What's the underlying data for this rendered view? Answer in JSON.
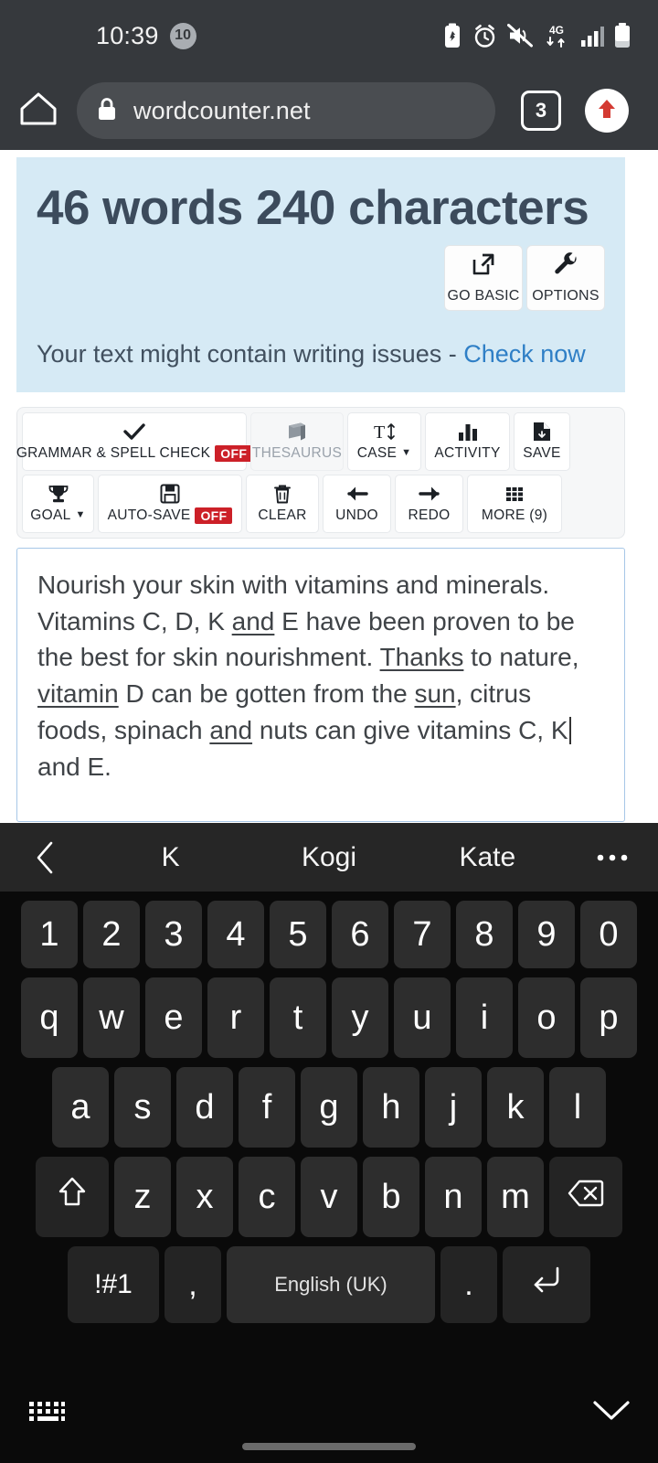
{
  "status_bar": {
    "time": "10:39",
    "notification_count": "10",
    "icons": [
      "battery-saver-icon",
      "alarm-icon",
      "mute-icon",
      "network-4g-icon",
      "signal-bars-icon",
      "battery-icon"
    ]
  },
  "browser": {
    "home_icon": "home-icon",
    "lock_icon": "lock-icon",
    "url": "wordcounter.net",
    "tab_count": "3",
    "upload_icon": "upload-arrow-icon"
  },
  "hero": {
    "headline": "46 words 240 characters",
    "word_count": "46",
    "character_count": "240",
    "buttons": [
      {
        "label": "GO BASIC",
        "icon": "external-link-icon"
      },
      {
        "label": "OPTIONS",
        "icon": "wrench-icon"
      }
    ],
    "notice_text": "Your text might contain writing issues - ",
    "notice_link": "Check now",
    "bg_color": "#d6eaf5",
    "link_color": "#2f7fc6"
  },
  "toolbar": {
    "row1": [
      {
        "label": "GRAMMAR & SPELL CHECK",
        "icon": "check-icon",
        "badge": "OFF",
        "disabled": false,
        "caret": false
      },
      {
        "label": "THESAURUS",
        "icon": "book-icon",
        "badge": "",
        "disabled": true,
        "caret": false
      },
      {
        "label": "CASE",
        "icon": "text-height-icon",
        "badge": "",
        "disabled": false,
        "caret": true
      },
      {
        "label": "ACTIVITY",
        "icon": "bar-chart-icon",
        "badge": "",
        "disabled": false,
        "caret": false
      },
      {
        "label": "SAVE",
        "icon": "save-file-icon",
        "badge": "",
        "disabled": false,
        "caret": false
      },
      {
        "label": "GOAL",
        "icon": "trophy-icon",
        "badge": "",
        "disabled": false,
        "caret": true
      }
    ],
    "row2": [
      {
        "label": "AUTO-SAVE",
        "icon": "floppy-disk-icon",
        "badge": "OFF",
        "disabled": false,
        "caret": false
      },
      {
        "label": "CLEAR",
        "icon": "trash-icon",
        "badge": "",
        "disabled": false,
        "caret": false
      },
      {
        "label": "UNDO",
        "icon": "arrow-left-icon",
        "badge": "",
        "disabled": false,
        "caret": false
      },
      {
        "label": "REDO",
        "icon": "arrow-right-icon",
        "badge": "",
        "disabled": false,
        "caret": false
      },
      {
        "label": "MORE (9)",
        "icon": "grid-dots-icon",
        "badge": "",
        "disabled": false,
        "caret": false
      }
    ],
    "badge_color": "#cc2028"
  },
  "editor": {
    "text": "Nourish your skin with vitamins and minerals. Vitamins C, D, K and E have been proven to be the best for skin nourishment. Thanks to nature, vitamin D can be gotten from the sun, citrus foods, spinach and nuts can give vitamins C, K and E.",
    "segments": [
      {
        "t": "Nourish your skin with vitamins and minerals. Vitamins C, D, K ",
        "u": false
      },
      {
        "t": "and",
        "u": true
      },
      {
        "t": " E have been proven to be the best for skin nourishment. ",
        "u": false
      },
      {
        "t": "Thanks",
        "u": true
      },
      {
        "t": " to nature, ",
        "u": false
      },
      {
        "t": "vitamin",
        "u": true
      },
      {
        "t": " D can be gotten from the ",
        "u": false
      },
      {
        "t": "sun",
        "u": true
      },
      {
        "t": ", citrus foods, spinach ",
        "u": false
      },
      {
        "t": "and",
        "u": true
      },
      {
        "t": " nuts can give vitamins C, K",
        "u": false,
        "caret": true
      },
      {
        "t": " and E.",
        "u": false
      }
    ],
    "border_color": "#a7c7e7"
  },
  "keyboard": {
    "suggestions": [
      "K",
      "Kogi",
      "Kate"
    ],
    "back_icon": "chevron-left-icon",
    "more_icon": "overflow-dots-icon",
    "rows": {
      "numbers": [
        "1",
        "2",
        "3",
        "4",
        "5",
        "6",
        "7",
        "8",
        "9",
        "0"
      ],
      "top": [
        "q",
        "w",
        "e",
        "r",
        "t",
        "y",
        "u",
        "i",
        "o",
        "p"
      ],
      "middle": [
        "a",
        "s",
        "d",
        "f",
        "g",
        "h",
        "j",
        "k",
        "l"
      ],
      "bottom": [
        "z",
        "x",
        "c",
        "v",
        "b",
        "n",
        "m"
      ]
    },
    "shift_icon": "shift-up-icon",
    "backspace_icon": "backspace-icon",
    "symbols_key": "!#1",
    "comma_key": ",",
    "space_key": "English (UK)",
    "period_key": ".",
    "enter_icon": "enter-return-icon",
    "switch_keyboard_icon": "keyboard-icon",
    "hide_keyboard_icon": "chevron-down-icon"
  }
}
